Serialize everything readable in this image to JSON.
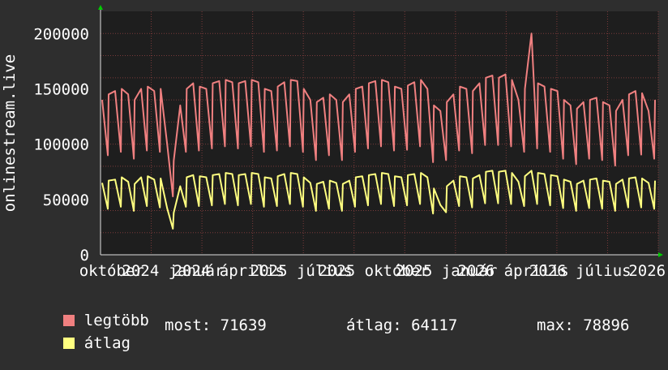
{
  "chart_data": {
    "type": "line",
    "ylabel": "onlinestream.live",
    "ylim": [
      0,
      220000
    ],
    "y_ticks": [
      0,
      50000,
      100000,
      150000,
      200000
    ],
    "y_tick_labels": [
      "0",
      "50000",
      "100000",
      "150000",
      "200000"
    ],
    "x_tick_labels": [
      "október",
      "2024 január",
      "2024 április",
      "2025 július",
      "2025 október",
      "2025 január",
      "2026 április",
      "2026 július",
      "2026"
    ],
    "grid": true,
    "series": [
      {
        "name": "legtöbb",
        "color": "#f08080",
        "values": [
          140000,
          145000,
          148000,
          150000,
          145000,
          140000,
          150000,
          152000,
          148000,
          150000,
          100000,
          85000,
          135000,
          150000,
          155000,
          152000,
          150000,
          155000,
          157000,
          158000,
          156000,
          155000,
          157000,
          158000,
          156000,
          150000,
          148000,
          152000,
          156000,
          158000,
          157000,
          150000,
          140000,
          138000,
          142000,
          145000,
          140000,
          138000,
          145000,
          150000,
          152000,
          155000,
          157000,
          158000,
          156000,
          152000,
          150000,
          153000,
          156000,
          158000,
          150000,
          135000,
          130000,
          138000,
          145000,
          152000,
          150000,
          148000,
          155000,
          160000,
          162000,
          160000,
          163000,
          158000,
          140000,
          150000,
          200000,
          155000,
          152000,
          150000,
          148000,
          140000,
          135000,
          132000,
          138000,
          140000,
          142000,
          138000,
          135000,
          130000,
          140000,
          145000,
          148000,
          146000,
          130000,
          140000
        ]
      },
      {
        "name": "átlag",
        "color": "#ffff80",
        "values": [
          65000,
          67000,
          68000,
          70000,
          66000,
          64000,
          70000,
          71000,
          68000,
          69000,
          42000,
          38000,
          62000,
          70000,
          72000,
          71000,
          70000,
          72000,
          73000,
          74000,
          73000,
          72000,
          73000,
          74000,
          73000,
          70000,
          69000,
          71000,
          73000,
          74000,
          73000,
          70000,
          65000,
          64000,
          66000,
          67000,
          65000,
          64000,
          67000,
          70000,
          71000,
          72000,
          73000,
          74000,
          73000,
          71000,
          70000,
          72000,
          73000,
          74000,
          70000,
          60000,
          45000,
          62000,
          67000,
          71000,
          70000,
          69000,
          72000,
          75000,
          76000,
          75000,
          76000,
          74000,
          66000,
          71000,
          76000,
          74000,
          73000,
          72000,
          71000,
          68000,
          66000,
          64000,
          67000,
          68000,
          69000,
          67000,
          66000,
          64000,
          68000,
          69000,
          70000,
          69000,
          65000,
          67000
        ]
      }
    ]
  },
  "legend": {
    "items": [
      {
        "label": "legtöbb",
        "color": "#f08080"
      },
      {
        "label": "átlag",
        "color": "#ffff80"
      }
    ],
    "stats": {
      "most": "most: 71639",
      "atlag": "átlag: 64117",
      "max": "max: 78896"
    }
  },
  "colors": {
    "background": "#2e2e2e",
    "plot_background": "#1e1e1e",
    "grid": "#7a3a3a",
    "axis": "#dddddd",
    "arrow": "#00cc00"
  }
}
